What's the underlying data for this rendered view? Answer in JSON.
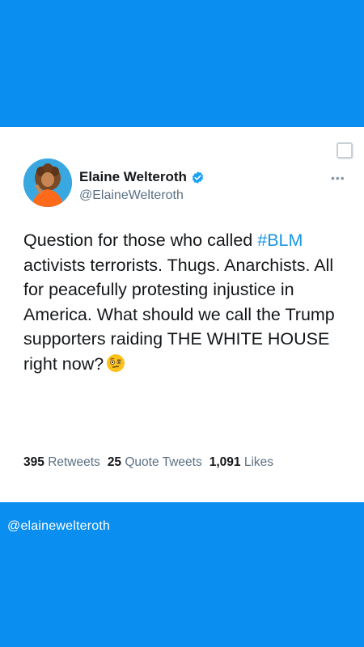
{
  "colors": {
    "background": "#0a8ef0",
    "accent": "#1b95e0",
    "verified": "#1da1f2"
  },
  "tweet": {
    "author_name": "Elaine Welteroth",
    "handle": "@ElaineWelteroth",
    "more_icon": "more-horizontal-icon",
    "verified_icon": "verified-badge-icon",
    "text_before_tag": "Question for those who called ",
    "hashtag": "#BLM",
    "text_after_tag": " activists terrorists. Thugs. Anarchists. All for peacefully protesting injustice in America. What should we call the Trump supporters raiding THE WHITE HOUSE right now?",
    "emoji_icon": "face-with-raised-eyebrow-icon",
    "stats": {
      "retweets_count": "395",
      "retweets_label": "Retweets",
      "quotes_count": "25",
      "quotes_label": "Quote Tweets",
      "likes_count": "1,091",
      "likes_label": "Likes"
    }
  },
  "footer": {
    "handle": "@elainewelteroth"
  }
}
